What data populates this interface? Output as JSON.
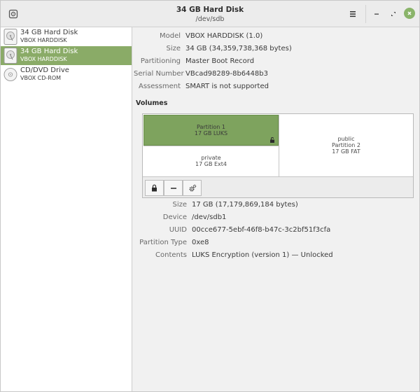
{
  "window": {
    "title": "34 GB Hard Disk",
    "subtitle": "/dev/sdb",
    "icons": {
      "app": "disks-app-icon",
      "menu": "hamburger-menu-icon",
      "minimize": "minimize-icon",
      "maximize": "maximize-icon",
      "close": "close-icon"
    },
    "colors": {
      "accent": "#8aab67",
      "close": "#8ab46a"
    }
  },
  "sidebar": {
    "items": [
      {
        "name": "34 GB Hard Disk",
        "sub": "VBOX HARDDISK",
        "icon": "hard-disk-icon"
      },
      {
        "name": "34 GB Hard Disk",
        "sub": "VBOX HARDDISK",
        "icon": "hard-disk-icon",
        "selected": true
      },
      {
        "name": "CD/DVD Drive",
        "sub": "VBOX CD-ROM",
        "icon": "optical-drive-icon"
      }
    ]
  },
  "disk_info": {
    "model_label": "Model",
    "model": "VBOX HARDDISK (1.0)",
    "size_label": "Size",
    "size": "34 GB (34,359,738,368 bytes)",
    "partitioning_label": "Partitioning",
    "partitioning": "Master Boot Record",
    "serial_label": "Serial Number",
    "serial": "VBcad98289-8b6448b3",
    "assessment_label": "Assessment",
    "assessment": "SMART is not supported"
  },
  "volumes": {
    "title": "Volumes",
    "partition1": {
      "name": "Partition 1",
      "detail": "17 GB LUKS"
    },
    "private": {
      "name": "private",
      "detail": "17 GB Ext4"
    },
    "partition2": {
      "label": "public",
      "name": "Partition 2",
      "detail": "17 GB FAT"
    },
    "toolbar_icons": [
      "lock-icon",
      "minus-icon",
      "gears-icon"
    ]
  },
  "partition_info": {
    "size_label": "Size",
    "size": "17 GB (17,179,869,184 bytes)",
    "device_label": "Device",
    "device": "/dev/sdb1",
    "uuid_label": "UUID",
    "uuid": "00cce677-5ebf-46f8-b47c-3c2bf51f3cfa",
    "type_label": "Partition Type",
    "type": "0xe8",
    "contents_label": "Contents",
    "contents": "LUKS Encryption (version 1) — Unlocked"
  }
}
